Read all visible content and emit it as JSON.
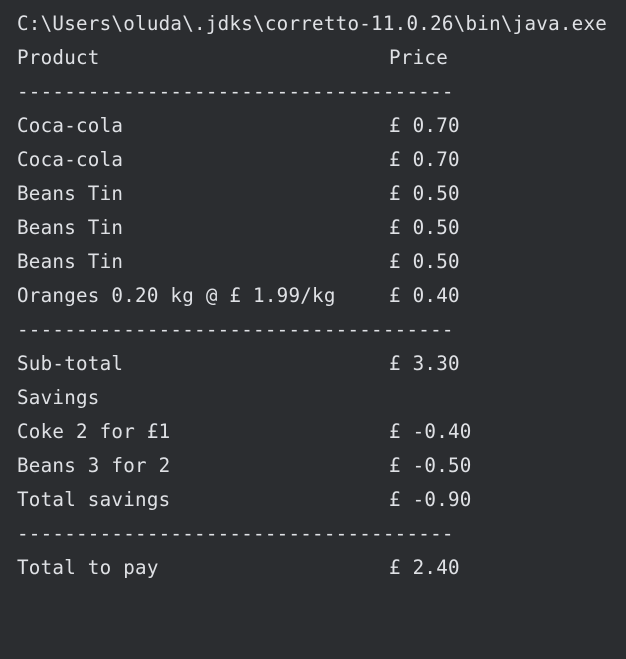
{
  "console": {
    "command": "C:\\Users\\oluda\\.jdks\\corretto-11.0.26\\bin\\java.exe",
    "header": {
      "product": "Product",
      "price": "Price"
    },
    "divider": "-------------------------------------",
    "items": [
      {
        "name": "Coca-cola",
        "price": "£ 0.70"
      },
      {
        "name": "Coca-cola",
        "price": "£ 0.70"
      },
      {
        "name": "Beans Tin",
        "price": "£ 0.50"
      },
      {
        "name": "Beans Tin",
        "price": "£ 0.50"
      },
      {
        "name": "Beans Tin",
        "price": "£ 0.50"
      },
      {
        "name": "Oranges 0.20 kg @ £ 1.99/kg",
        "price": "£ 0.40"
      }
    ],
    "subtotal": {
      "label": "Sub-total",
      "value": "£ 3.30"
    },
    "savings_label": "Savings",
    "savings": [
      {
        "name": "Coke 2 for £1",
        "value": "£ -0.40"
      },
      {
        "name": "Beans 3 for 2",
        "value": "£ -0.50"
      }
    ],
    "total_savings": {
      "label": "Total savings",
      "value": "£ -0.90"
    },
    "total_to_pay": {
      "label": "Total to pay",
      "value": "£ 2.40"
    }
  }
}
